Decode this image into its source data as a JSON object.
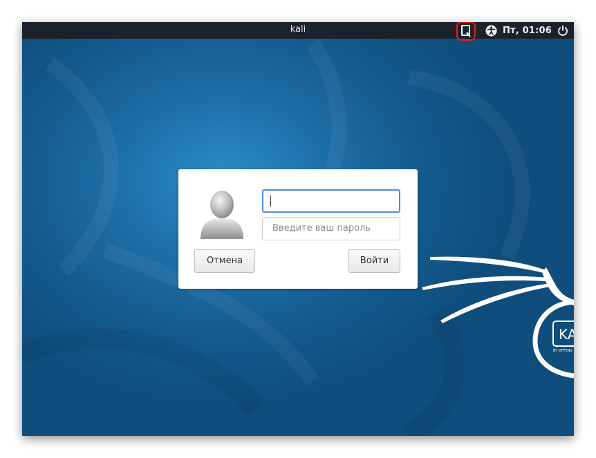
{
  "topbar": {
    "title": "kali",
    "clock": "Пт, 01:06",
    "icons": [
      "keyboard-layout-icon",
      "accessibility-icon",
      "power-icon"
    ]
  },
  "login": {
    "username_value": "",
    "password_placeholder": "Введите ваш пароль",
    "cancel_label": "Отмена",
    "login_label": "Войти"
  },
  "colors": {
    "highlight": "#e02020",
    "input_focus": "#4b8fdc",
    "panel": "#1c2229",
    "background": "#1a6aa3"
  }
}
